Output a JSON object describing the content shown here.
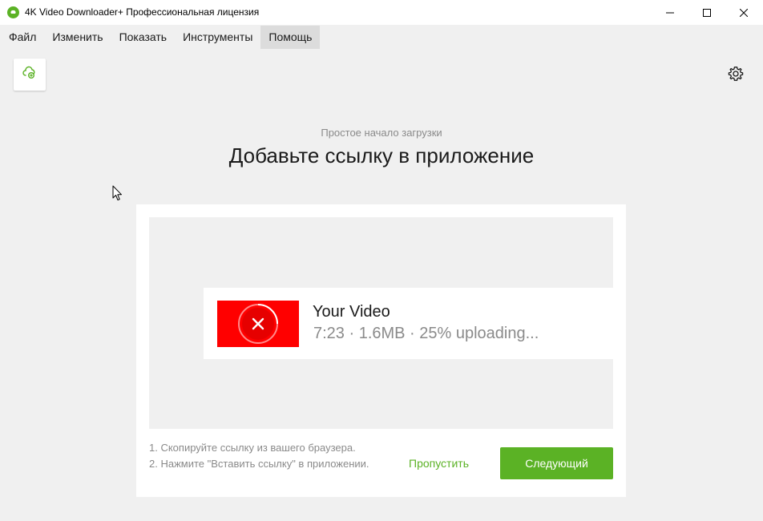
{
  "window": {
    "title": "4K Video Downloader+ Профессиональная лицензия",
    "controls": [
      "minimize-icon",
      "maximize-icon",
      "close-icon"
    ]
  },
  "menu": {
    "items": [
      "Файл",
      "Изменить",
      "Показать",
      "Инструменты",
      "Помощь"
    ],
    "active_item": "Помощь"
  },
  "toolbar": {
    "paste_icon": "link-plus-icon",
    "settings_icon": "gear-icon"
  },
  "onboarding": {
    "subtitle": "Простое начало загрузки",
    "headline": "Добавьте ссылку в приложение",
    "demo": {
      "video_title": "Your Video",
      "video_meta": "7:23 · 1.6MB · 25% uploading...",
      "status_icon": "error-x-icon"
    },
    "steps": {
      "step1": "1. Скопируйте ссылку из вашего браузера.",
      "step2": "2. Нажмите \"Вставить ссылку\" в приложении."
    },
    "skip_label": "Пропустить",
    "next_label": "Следующий"
  },
  "colors": {
    "accent": "#5bb225",
    "thumb": "#ff0000",
    "background": "#f0f0f0",
    "muted_text": "#8a8a8a"
  }
}
